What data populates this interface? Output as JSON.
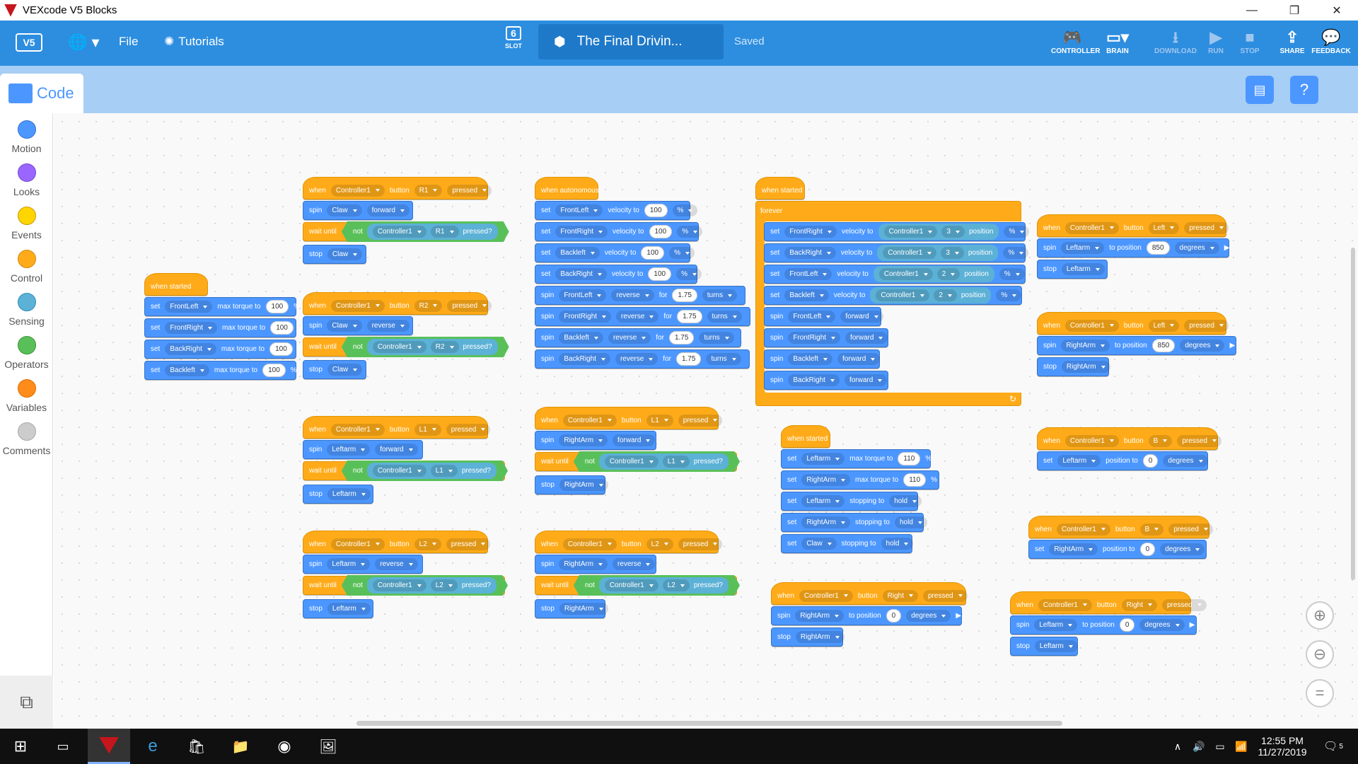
{
  "window": {
    "title": "VEXcode V5 Blocks",
    "minimize": "—",
    "maximize": "❐",
    "close": "✕"
  },
  "menubar": {
    "file": "File",
    "tutorials": "Tutorials",
    "slot_label": "SLOT",
    "slot_number": "6",
    "project_name": "The Final Drivin...",
    "save_status": "Saved",
    "buttons": [
      {
        "label": "CONTROLLER",
        "icon": "controller-icon"
      },
      {
        "label": "BRAIN",
        "icon": "brain-icon"
      },
      {
        "label": "DOWNLOAD",
        "icon": "download-icon"
      },
      {
        "label": "RUN",
        "icon": "run-icon"
      },
      {
        "label": "STOP",
        "icon": "stop-icon"
      },
      {
        "label": "SHARE",
        "icon": "share-icon"
      },
      {
        "label": "FEEDBACK",
        "icon": "feedback-icon"
      }
    ]
  },
  "code_tab": {
    "label": "Code"
  },
  "categories": [
    {
      "label": "Motion",
      "color": "#4c97ff"
    },
    {
      "label": "Looks",
      "color": "#9966ff"
    },
    {
      "label": "Events",
      "color": "#ffd500"
    },
    {
      "label": "Control",
      "color": "#ffab19"
    },
    {
      "label": "Sensing",
      "color": "#5cb1d6"
    },
    {
      "label": "Operators",
      "color": "#59c059"
    },
    {
      "label": "Variables",
      "color": "#ff8c1a"
    },
    {
      "label": "Comments",
      "color": "#cccccc"
    }
  ],
  "blocks": {
    "s1_hat": "when started",
    "s1_rows": [
      [
        "set",
        "FrontLeft",
        "max torque to",
        "100",
        "%"
      ],
      [
        "set",
        "FrontRight",
        "max torque to",
        "100",
        "%"
      ],
      [
        "set",
        "BackRight",
        "max torque to",
        "100",
        "%"
      ],
      [
        "set",
        "Backleft",
        "max torque to",
        "100",
        "%"
      ]
    ],
    "r1": {
      "when": "when",
      "ctrl": "Controller1",
      "button": "button",
      "btn": "R1",
      "pressed": "pressed",
      "spin": "spin",
      "motor": "Claw",
      "dir": "forward",
      "wait": "wait until",
      "not": "not",
      "pq": "pressed?",
      "stop": "stop"
    },
    "r2": {
      "btn": "R2",
      "dir": "reverse",
      "motor": "Claw"
    },
    "l1": {
      "btn": "L1",
      "dir": "forward",
      "motor": "Leftarm"
    },
    "l2": {
      "btn": "L2",
      "dir": "reverse",
      "motor": "Leftarm"
    },
    "auto_hat": "when autonomous",
    "auto_rows": [
      [
        "set",
        "FrontLeft",
        "velocity to",
        "100",
        "%"
      ],
      [
        "set",
        "FrontRight",
        "velocity to",
        "100",
        "%"
      ],
      [
        "set",
        "Backleft",
        "velocity to",
        "100",
        "%"
      ],
      [
        "set",
        "BackRight",
        "velocity to",
        "100",
        "%"
      ],
      [
        "spin",
        "FrontLeft",
        "reverse",
        "for",
        "1.75",
        "turns"
      ],
      [
        "spin",
        "FrontRight",
        "reverse",
        "for",
        "1.75",
        "turns"
      ],
      [
        "spin",
        "Backleft",
        "reverse",
        "for",
        "1.75",
        "turns"
      ],
      [
        "spin",
        "BackRight",
        "reverse",
        "for",
        "1.75",
        "turns"
      ]
    ],
    "ra_l1": {
      "btn": "L1",
      "dir": "forward",
      "motor": "RightArm"
    },
    "ra_l2": {
      "btn": "L2",
      "dir": "reverse",
      "motor": "RightArm"
    },
    "drive_hat": "when started",
    "forever": "forever",
    "drive_rows": [
      [
        "set",
        "FrontRight",
        "velocity to",
        "Controller1",
        "3",
        "position",
        "%"
      ],
      [
        "set",
        "BackRight",
        "velocity to",
        "Controller1",
        "3",
        "position",
        "%"
      ],
      [
        "set",
        "FrontLeft",
        "velocity to",
        "Controller1",
        "2",
        "position",
        "%"
      ],
      [
        "set",
        "Backleft",
        "velocity to",
        "Controller1",
        "2",
        "position",
        "%"
      ]
    ],
    "drive_spin": [
      [
        "spin",
        "FrontLeft",
        "forward"
      ],
      [
        "spin",
        "FrontRight",
        "forward"
      ],
      [
        "spin",
        "Backleft",
        "forward"
      ],
      [
        "spin",
        "BackRight",
        "forward"
      ]
    ],
    "arm_hat": "when started",
    "arm_rows": [
      [
        "set",
        "Leftarm",
        "max torque to",
        "110",
        "%"
      ],
      [
        "set",
        "RightArm",
        "max torque to",
        "110",
        "%"
      ],
      [
        "set",
        "Leftarm",
        "stopping to",
        "hold"
      ],
      [
        "set",
        "RightArm",
        "stopping to",
        "hold"
      ],
      [
        "set",
        "Claw",
        "stopping to",
        "hold"
      ]
    ],
    "right_r": {
      "btn": "Right",
      "motor": "RightArm",
      "pos": "0",
      "to": "to position",
      "deg": "degrees"
    },
    "left1": {
      "btn": "Left",
      "motor": "Leftarm",
      "pos": "850"
    },
    "left2": {
      "btn": "Left",
      "motor": "RightArm",
      "pos": "850"
    },
    "b1": {
      "btn": "B",
      "motor": "Leftarm",
      "pos": "0",
      "label": "position to"
    },
    "b2": {
      "btn": "B",
      "motor": "RightArm",
      "pos": "0"
    },
    "right_l": {
      "btn": "Right",
      "motor": "Leftarm",
      "pos": "0"
    }
  },
  "taskbar": {
    "time": "12:55 PM",
    "date": "11/27/2019",
    "notif": "5"
  }
}
